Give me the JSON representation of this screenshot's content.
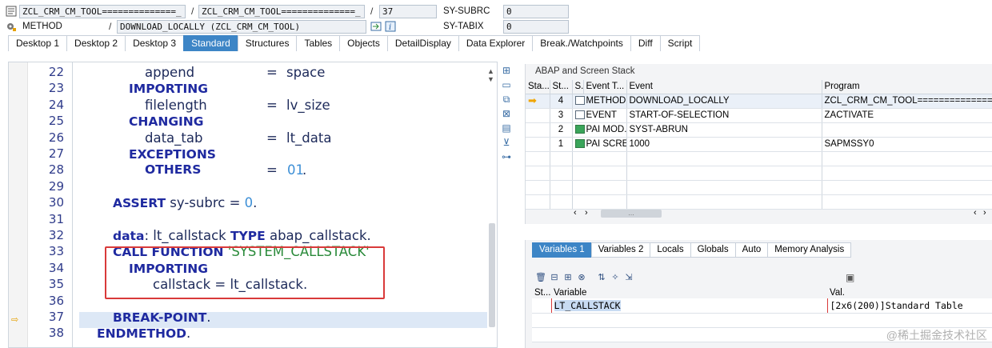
{
  "header": {
    "row1": {
      "field_a": "ZCL_CRM_CM_TOOL==============_",
      "field_b": "ZCL_CRM_CM_TOOL==============_",
      "line_no": "37",
      "sysvar": "SY-SUBRC",
      "sysval": "0"
    },
    "row2": {
      "kind": "METHOD",
      "method": "DOWNLOAD_LOCALLY (ZCL_CRM_CM_TOOL)",
      "sysvar": "SY-TABIX",
      "sysval": "0"
    }
  },
  "tabs": [
    "Desktop 1",
    "Desktop 2",
    "Desktop 3",
    "Standard",
    "Structures",
    "Tables",
    "Objects",
    "DetailDisplay",
    "Data Explorer",
    "Break./Watchpoints",
    "Diff",
    "Script"
  ],
  "active_tab": "Standard",
  "editor": {
    "lines": [
      {
        "n": "22"
      },
      {
        "n": "23"
      },
      {
        "n": "24"
      },
      {
        "n": "25"
      },
      {
        "n": "26"
      },
      {
        "n": "27"
      },
      {
        "n": "28"
      },
      {
        "n": "29"
      },
      {
        "n": "30"
      },
      {
        "n": "31"
      },
      {
        "n": "32"
      },
      {
        "n": "33"
      },
      {
        "n": "34"
      },
      {
        "n": "35"
      },
      {
        "n": "36"
      },
      {
        "n": "37"
      },
      {
        "n": "38"
      }
    ],
    "tokens": {
      "append": "append",
      "eq": "=",
      "space": "space",
      "importing": "IMPORTING",
      "filelength": "filelength",
      "lv_size": "lv_size",
      "changing": "CHANGING",
      "data_tab": "data_tab",
      "lt_data": "lt_data",
      "exceptions": "EXCEPTIONS",
      "others": "OTHERS",
      "num01": "01",
      "dot": ".",
      "assert": "ASSERT",
      "sy_subrc": "sy-subrc",
      "zero": "0",
      "data": "data",
      "colon": ":",
      "lt_callstack": "lt_callstack",
      "type": "TYPE",
      "abap_callstack": "abap_callstack",
      "call_function": "CALL FUNCTION",
      "system_callstack": "'SYSTEM_CALLSTACK'",
      "callstack": "callstack",
      "break_point": "BREAK-POINT",
      "endmethod": "ENDMETHOD"
    }
  },
  "stack_panel": {
    "title": "ABAP and Screen Stack",
    "headers": [
      "Sta...",
      "St...",
      "S..",
      "Event T...",
      "Event",
      "Program"
    ],
    "rows": [
      {
        "level": "4",
        "type": "METHOD",
        "event": "DOWNLOAD_LOCALLY",
        "program": "ZCL_CRM_CM_TOOL==============",
        "current": true
      },
      {
        "level": "3",
        "type": "EVENT",
        "event": "START-OF-SELECTION",
        "program": "ZACTIVATE",
        "current": false
      },
      {
        "level": "2",
        "type": "PAI MOD..",
        "event": "SYST-ABRUN",
        "program": "",
        "current": false
      },
      {
        "level": "1",
        "type": "PAI SCRE..",
        "event": "1000",
        "program": "SAPMSSY0",
        "current": false
      }
    ]
  },
  "var_panel": {
    "tabs": [
      "Variables 1",
      "Variables 2",
      "Locals",
      "Globals",
      "Auto",
      "Memory Analysis"
    ],
    "active_tab": "Variables 1",
    "headers": [
      "St...",
      "Variable",
      "Val."
    ],
    "rows": [
      {
        "variable": "LT_CALLSTACK",
        "value": "[2x6(200)]Standard Table"
      }
    ]
  },
  "watermark": "@稀土掘金技术社区",
  "colors": {
    "accent": "#3d85c6",
    "highlight_box": "#d93a3a",
    "keyword": "#1f2aa0"
  }
}
